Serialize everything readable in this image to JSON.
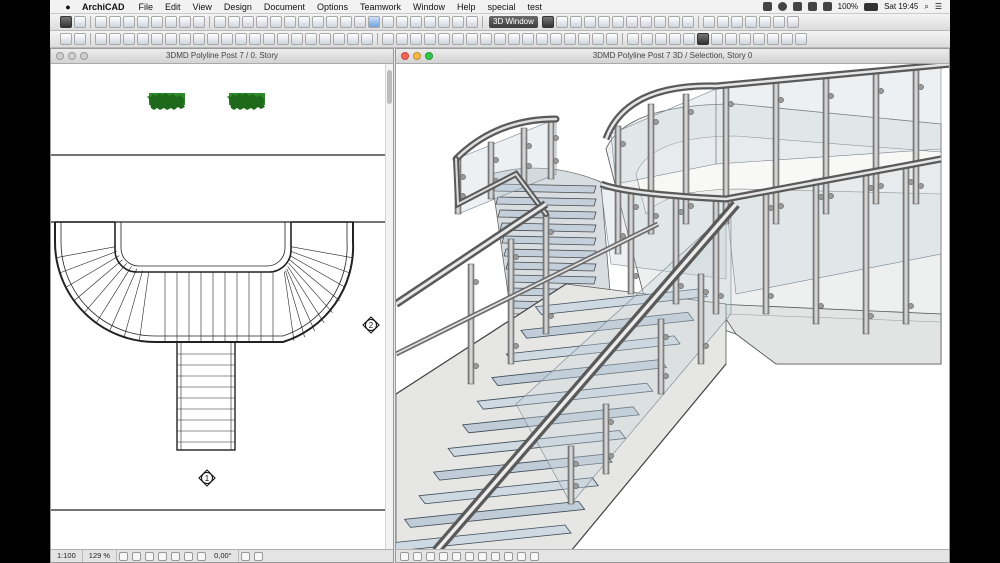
{
  "menubar": {
    "apple_icon": "apple-icon",
    "app_name": "ArchiCAD",
    "items": [
      "File",
      "Edit",
      "View",
      "Design",
      "Document",
      "Options",
      "Teamwork",
      "Window",
      "Help",
      "special",
      "test"
    ],
    "battery": "100%",
    "clock": "Sat 19:45"
  },
  "toolbar": {
    "window_button_label": "3D Window"
  },
  "floorplan": {
    "title": "3DMD Polyline Post 7 / 0. Story",
    "marker_1": "1",
    "marker_2": "2",
    "status": {
      "scale": "1:100",
      "zoom": "129 %",
      "angle": "0,00°"
    }
  },
  "view3d": {
    "title": "3DMD Polyline Post 7 3D / Selection, Story 0"
  },
  "colors": {
    "background": "#000000",
    "close_light": "#fc605b",
    "minimize_light": "#fdbc40",
    "zoom_light": "#34c84a",
    "glass": "#c8d4de"
  }
}
